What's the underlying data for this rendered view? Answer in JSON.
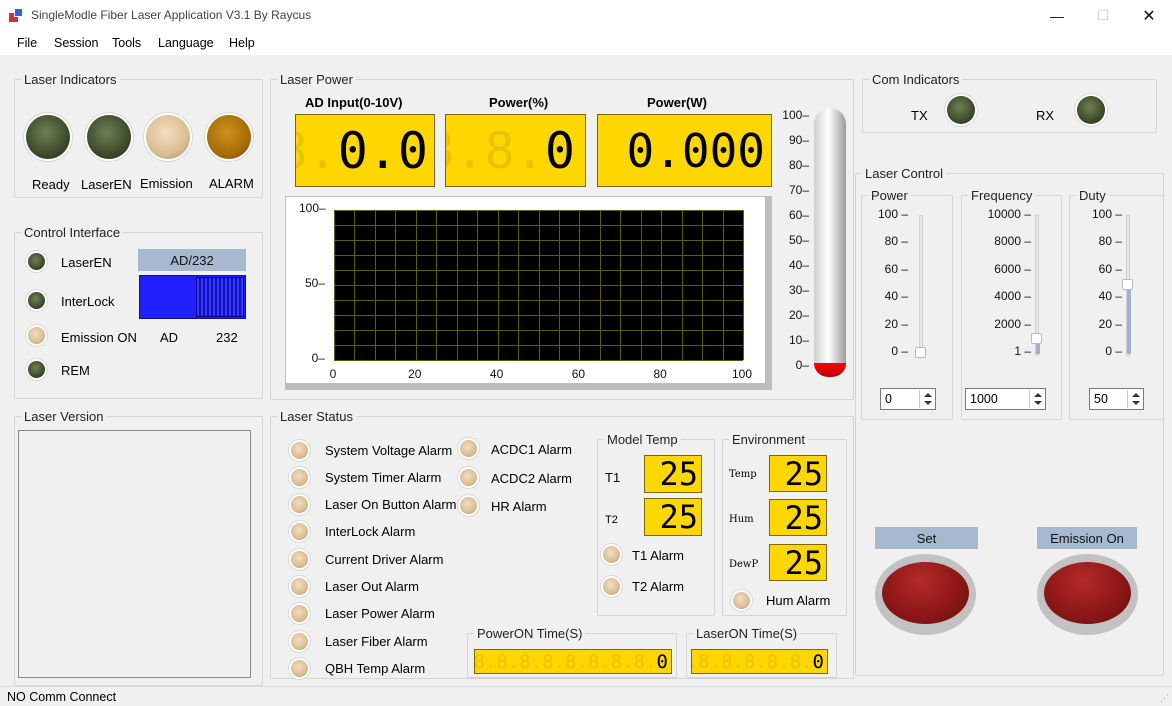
{
  "window": {
    "title": "SingleModle Fiber Laser Application V3.1  By Raycus"
  },
  "menu": [
    "File",
    "Session",
    "Tools",
    "Language",
    "Help"
  ],
  "laser_indicators": {
    "title": "Laser Indicators",
    "items": [
      {
        "label": "Ready",
        "color": "olive"
      },
      {
        "label": "LaserEN",
        "color": "olive"
      },
      {
        "label": "Emission",
        "color": "cream"
      },
      {
        "label": "ALARM",
        "color": "amber"
      }
    ]
  },
  "control_interface": {
    "title": "Control Interface",
    "leds": [
      "LaserEN",
      "InterLock",
      "Emission ON",
      "REM"
    ],
    "mode_label": "AD/232",
    "switch_left": "AD",
    "switch_right": "232"
  },
  "laser_version": {
    "title": "Laser Version"
  },
  "laser_power": {
    "title": "Laser Power",
    "ad_label": "AD Input(0-10V)",
    "ad_ghost": "8.",
    "ad_value": "0.0",
    "pct_label": "Power(%)",
    "pct_ghost": "8.8.",
    "pct_value": "0",
    "w_label": "Power(W)",
    "w_value": "0.000",
    "therm_ticks": [
      "100",
      "90",
      "80",
      "70",
      "60",
      "50",
      "40",
      "30",
      "20",
      "10",
      "0"
    ],
    "thermometer_level_percent": 0
  },
  "chart_data": {
    "type": "line",
    "xlim": [
      0,
      100
    ],
    "ylim": [
      0,
      100
    ],
    "x_ticks": [
      "0",
      "20",
      "40",
      "60",
      "80",
      "100"
    ],
    "y_ticks": [
      "100",
      "50",
      "0"
    ],
    "series": []
  },
  "com_indicators": {
    "title": "Com Indicators",
    "tx": "TX",
    "rx": "RX"
  },
  "laser_control": {
    "title": "Laser Control",
    "power": {
      "label": "Power",
      "ticks": [
        "100",
        "80",
        "60",
        "40",
        "20",
        "0"
      ],
      "value": "0"
    },
    "frequency": {
      "label": "Frequency",
      "ticks": [
        "10000",
        "8000",
        "6000",
        "4000",
        "2000",
        "1"
      ],
      "value": "1000"
    },
    "duty": {
      "label": "Duty",
      "ticks": [
        "100",
        "80",
        "60",
        "40",
        "20",
        "0"
      ],
      "value": "50"
    },
    "set_label": "Set",
    "emission_label": "Emission On"
  },
  "laser_status": {
    "title": "Laser Status",
    "alarms_col1": [
      "System Voltage Alarm",
      "System Timer Alarm",
      "Laser On Button Alarm",
      "InterLock Alarm",
      "Current Driver Alarm",
      "Laser Out Alarm",
      "Laser Power Alarm",
      "Laser Fiber Alarm",
      "QBH Temp Alarm"
    ],
    "alarms_col2": [
      "ACDC1 Alarm",
      "ACDC2 Alarm",
      "HR Alarm"
    ]
  },
  "model_temp": {
    "title": "Model Temp",
    "t1_label": "T1",
    "t1_value": "25",
    "t2_label": "T2",
    "t2_value": "25",
    "t1_alarm": "T1 Alarm",
    "t2_alarm": "T2 Alarm"
  },
  "environment": {
    "title": "Environment",
    "temp_label": "Temp",
    "temp_value": "25",
    "hum_label": "Hum",
    "hum_value": "25",
    "dewp_label": "DewP",
    "dewp_value": "25",
    "hum_alarm": "Hum Alarm"
  },
  "poweron_time": {
    "title": "PowerON Time(S)",
    "ghost": "8.8.8.8.8.8.8.8.8.",
    "value": "0"
  },
  "laseron_time": {
    "title": "LaserON Time(S)",
    "ghost": "8.8.8.8.8.8.",
    "value": "0"
  },
  "status_bar": {
    "text": "NO Comm Connect"
  }
}
